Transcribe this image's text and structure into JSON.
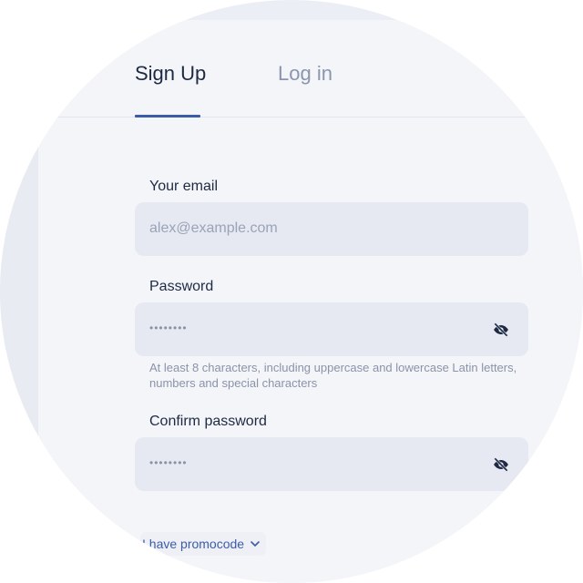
{
  "tabs": [
    {
      "label": "Sign Up",
      "active": true
    },
    {
      "label": "Log in",
      "active": false
    }
  ],
  "email": {
    "label": "Your email",
    "placeholder": "alex@example.com"
  },
  "password": {
    "label": "Password",
    "value_masked": "••••••••",
    "hint": "At least 8 characters, including uppercase and lowercase Latin letters, numbers and special characters",
    "toggle_icon": "eye-off-icon"
  },
  "confirm_password": {
    "label": "Confirm password",
    "value_masked": "••••••••",
    "toggle_icon": "eye-off-icon"
  },
  "promo": {
    "label": "I have promocode",
    "icon": "chevron-down-icon"
  },
  "colors": {
    "accent": "#3c5ba8",
    "text_primary": "#1e2a44",
    "text_muted": "#8a93a8",
    "field_bg": "#e6e9f2"
  }
}
